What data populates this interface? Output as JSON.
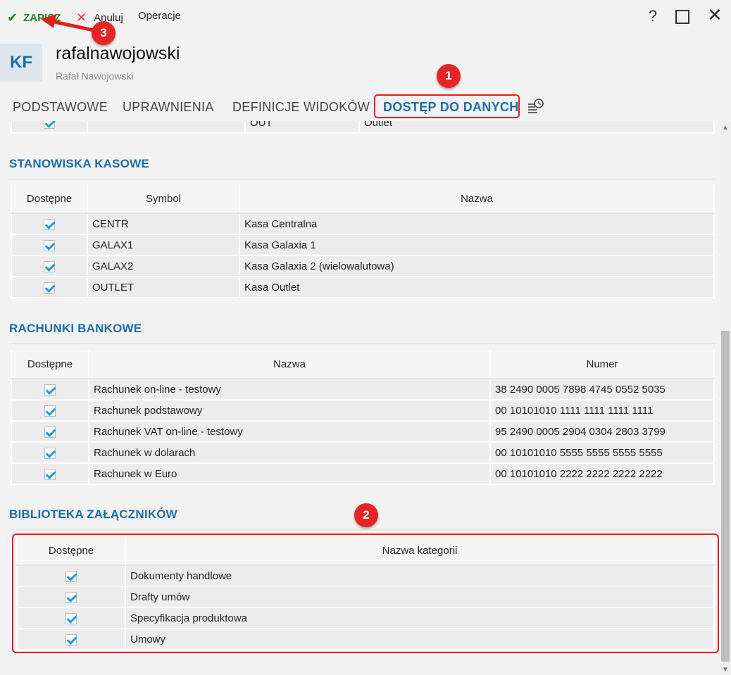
{
  "toolbar": {
    "save_label": "ZAPISZ",
    "cancel_label": "Anuluj",
    "operations_label": "Operacje",
    "help_label": "?"
  },
  "header": {
    "avatar_initials": "KF",
    "username": "rafalnawojowski",
    "full_name": "Rafał Nawojowski"
  },
  "tabs": [
    {
      "label": "PODSTAWOWE",
      "active": false
    },
    {
      "label": "UPRAWNIENIA",
      "active": false
    },
    {
      "label": "DEFINICJE WIDOKÓW",
      "active": false
    },
    {
      "label": "DOSTĘP DO DANYCH",
      "active": true
    }
  ],
  "partial_row": {
    "symbol": "OUT",
    "name": "Outlet",
    "checked": true
  },
  "stanowiska": {
    "title": "STANOWISKA KASOWE",
    "columns": [
      "Dostępne",
      "Symbol",
      "Nazwa"
    ],
    "rows": [
      {
        "symbol": "CENTR",
        "name": "Kasa Centralna",
        "checked": true
      },
      {
        "symbol": "GALAX1",
        "name": "Kasa Galaxia 1",
        "checked": true
      },
      {
        "symbol": "GALAX2",
        "name": "Kasa Galaxia 2 (wielowalutowa)",
        "checked": true
      },
      {
        "symbol": "OUTLET",
        "name": "Kasa Outlet",
        "checked": true
      }
    ]
  },
  "rachunki": {
    "title": "RACHUNKI BANKOWE",
    "columns": [
      "Dostępne",
      "Nazwa",
      "Numer"
    ],
    "rows": [
      {
        "name": "Rachunek on-line - testowy",
        "number": "38 2490 0005 7898 4745 0552 5035",
        "checked": true
      },
      {
        "name": "Rachunek podstawowy",
        "number": "00 10101010 1111 1111 1111 1111",
        "checked": true
      },
      {
        "name": "Rachunek VAT on-line - testowy",
        "number": "95 2490 0005 2904 0304 2803 3799",
        "checked": true
      },
      {
        "name": "Rachunek w dolarach",
        "number": "00 10101010 5555 5555 5555 5555",
        "checked": true
      },
      {
        "name": "Rachunek w Euro",
        "number": "00 10101010 2222 2222 2222 2222",
        "checked": true
      }
    ]
  },
  "biblioteka": {
    "title": "BIBLIOTEKA ZAŁĄCZNIKÓW",
    "columns": [
      "Dostępne",
      "Nazwa kategorii"
    ],
    "rows": [
      {
        "name": "Dokumenty handlowe",
        "checked": true
      },
      {
        "name": "Drafty umów",
        "checked": true
      },
      {
        "name": "Specyfikacja produktowa",
        "checked": true
      },
      {
        "name": "Umowy",
        "checked": true
      }
    ]
  },
  "annotations": {
    "badge_1": "1",
    "badge_2": "2",
    "badge_3": "3"
  },
  "colors": {
    "accent": "#1c6ea4",
    "save_green": "#1f8a2a",
    "cancel_red": "#e03a3a",
    "annotation_red": "#e02020",
    "checkbox_blue": "#1a9be0"
  }
}
